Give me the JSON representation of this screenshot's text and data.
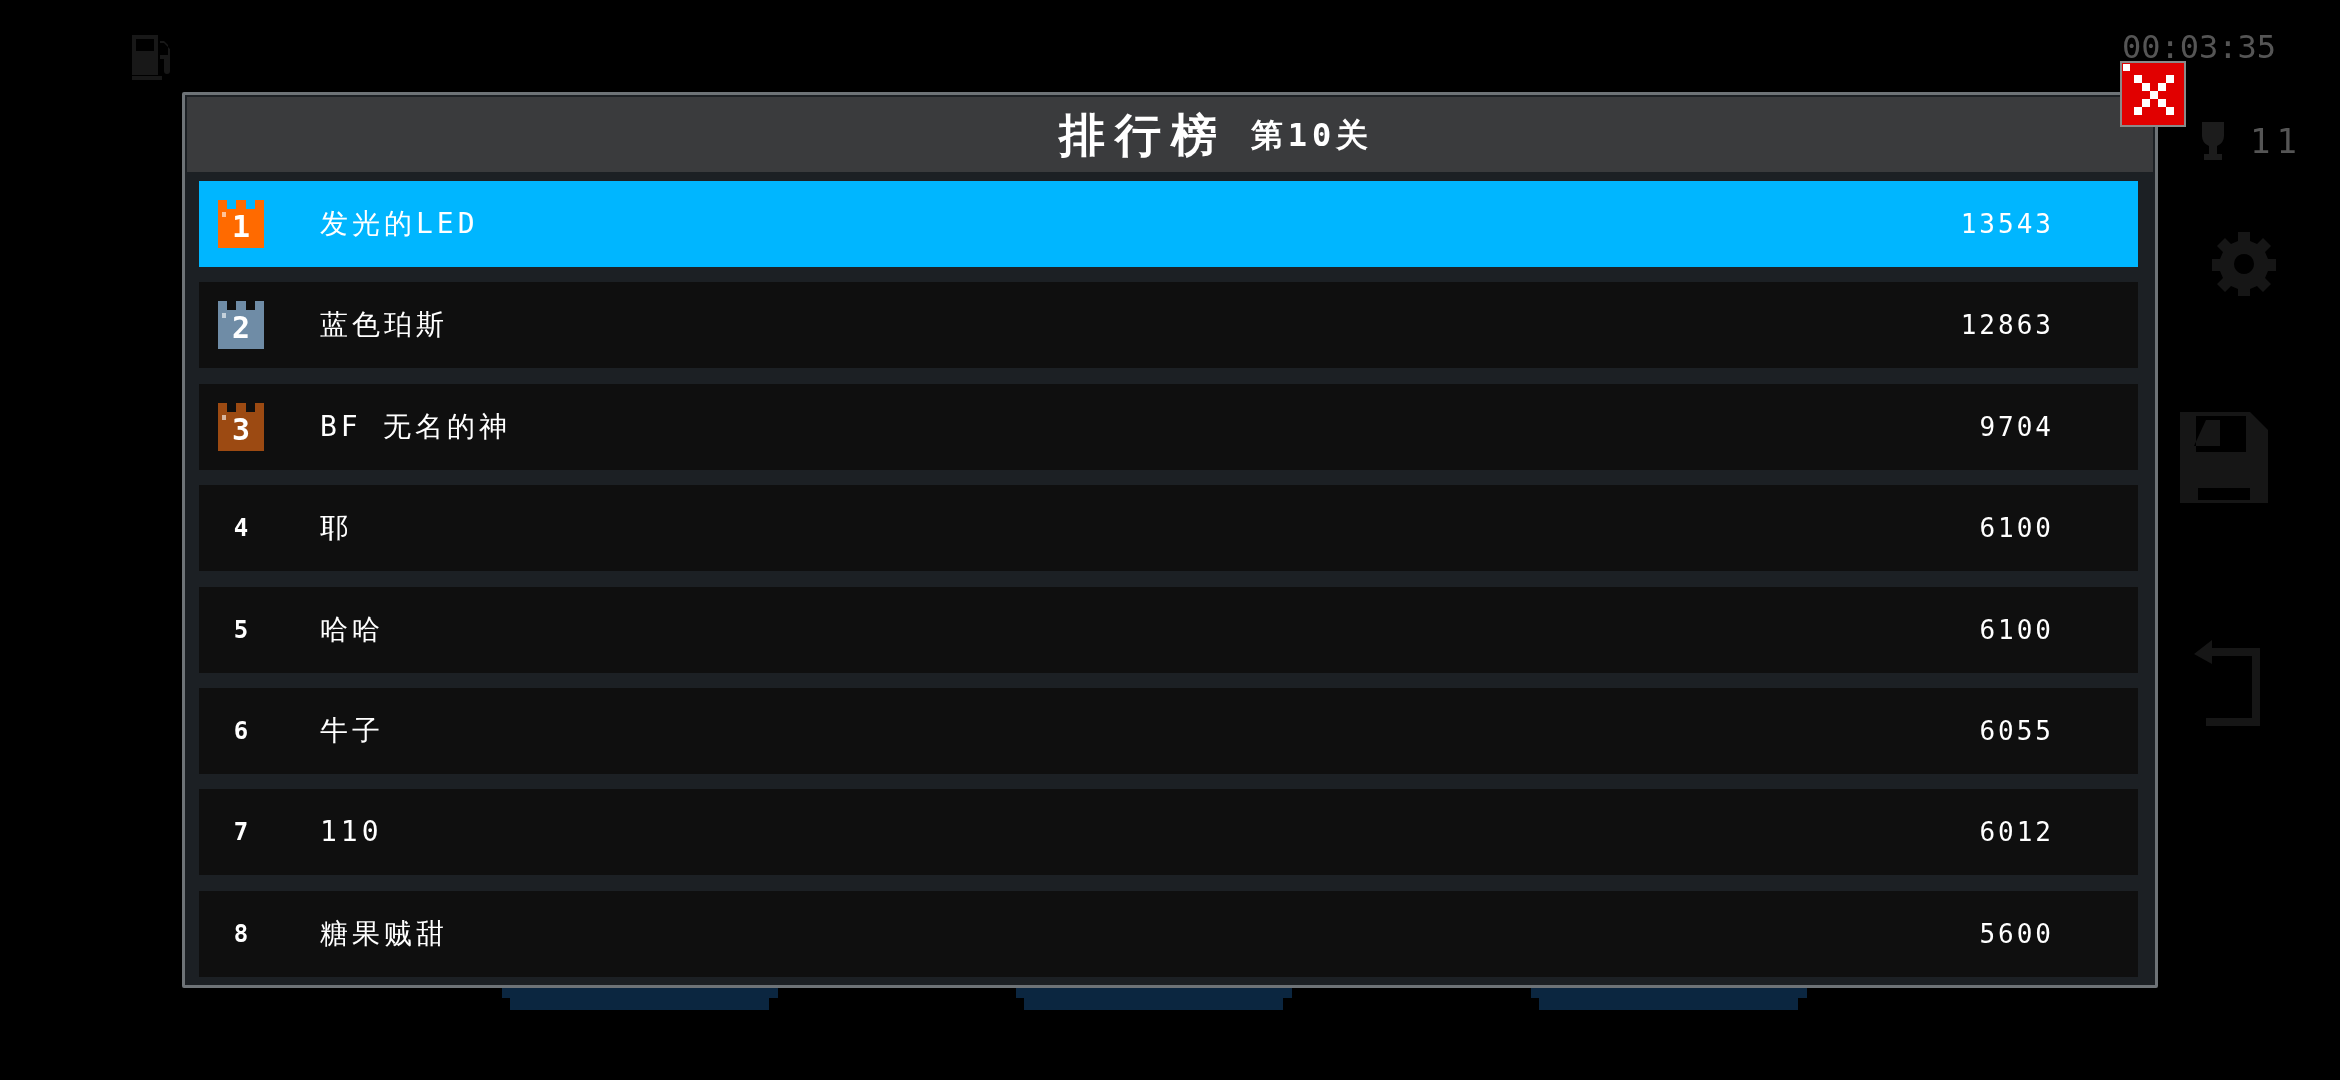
{
  "dialog": {
    "title": "排行榜",
    "subtitle": "第10关"
  },
  "rows": [
    {
      "rank": "1",
      "kind": "crown",
      "color": "#ff6a00",
      "name": "发光的LED",
      "score": "13543",
      "selected": true
    },
    {
      "rank": "2",
      "kind": "crown",
      "color": "#6f8ca6",
      "name": "蓝色珀斯",
      "score": "12863",
      "selected": false
    },
    {
      "rank": "3",
      "kind": "crown",
      "color": "#9c4a12",
      "name": "BF 无名的神",
      "score": "9704",
      "selected": false
    },
    {
      "rank": "4",
      "kind": "plain",
      "name": "耶",
      "score": "6100",
      "selected": false
    },
    {
      "rank": "5",
      "kind": "plain",
      "name": "哈哈",
      "score": "6100",
      "selected": false
    },
    {
      "rank": "6",
      "kind": "plain",
      "name": "牛子",
      "score": "6055",
      "selected": false
    },
    {
      "rank": "7",
      "kind": "plain",
      "name": "110",
      "score": "6012",
      "selected": false
    },
    {
      "rank": "8",
      "kind": "plain",
      "name": "糖果贼甜",
      "score": "5600",
      "selected": false
    }
  ],
  "background_hud": {
    "timer": "00:03:35",
    "trophy_count": "11"
  }
}
